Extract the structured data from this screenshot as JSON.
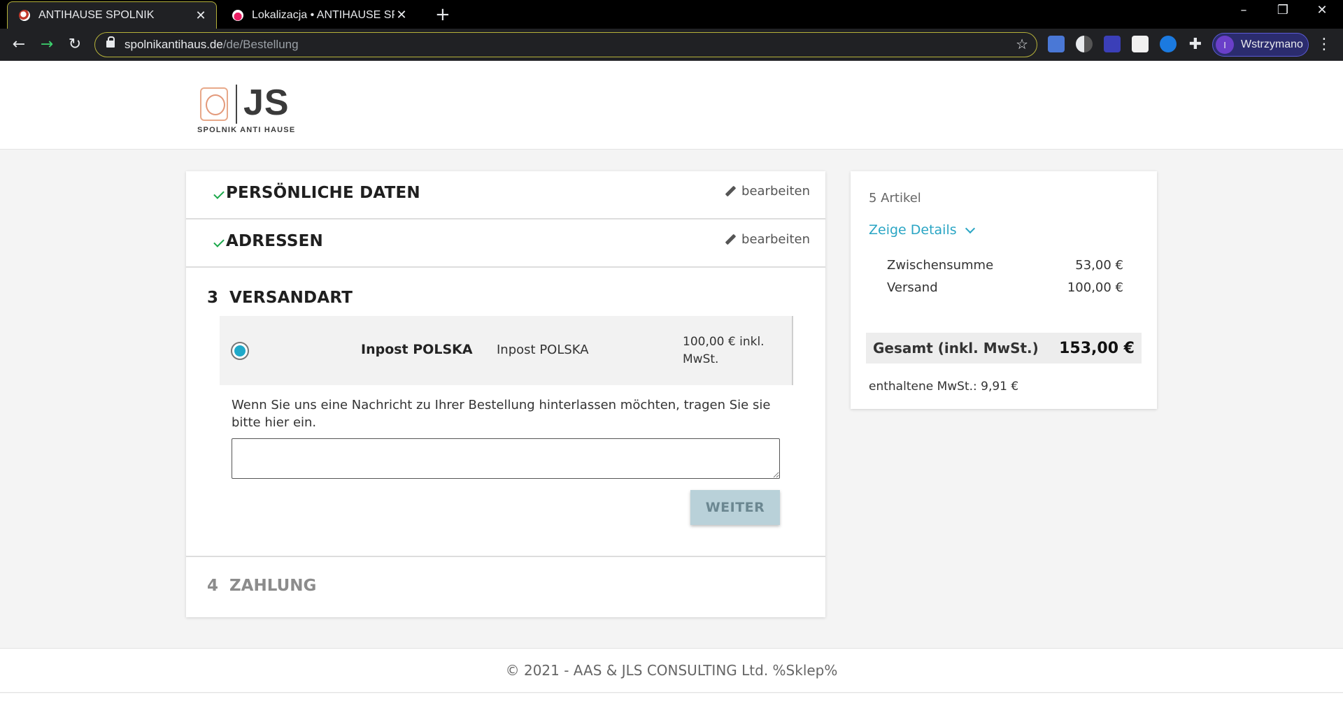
{
  "browser": {
    "tabs": [
      {
        "title": "ANTIHAUSE SPOLNIK",
        "active": true
      },
      {
        "title": "Lokalizacja • ANTIHAUSE SPOLNI",
        "active": false
      }
    ],
    "url_host": "spolnikantihaus.de",
    "url_path": "/de/Bestellung",
    "profile_initial": "I",
    "profile_label": "Wstrzymano",
    "accent_color": "#b5b13a"
  },
  "site": {
    "logo_letters": "JS",
    "logo_tagline": "SPOLNIK ANTI HAUSE"
  },
  "checkout": {
    "steps_done": [
      {
        "title": "PERSÖNLICHE DATEN",
        "edit_label": "bearbeiten"
      },
      {
        "title": "ADRESSEN",
        "edit_label": "bearbeiten"
      }
    ],
    "active_step": {
      "number": "3",
      "title": "VERSANDART",
      "option": {
        "name": "Inpost POLSKA",
        "description": "Inpost POLSKA",
        "price": "100,00 € inkl. MwSt.",
        "selected": true
      },
      "message_label": "Wenn Sie uns eine Nachricht zu Ihrer Bestellung hinterlassen möchten, tragen Sie sie bitte hier ein.",
      "message_value": "",
      "continue_label": "WEITER"
    },
    "pending_step": {
      "number": "4",
      "title": "ZAHLUNG"
    }
  },
  "summary": {
    "item_count": "5 Artikel",
    "details_label": "Zeige Details",
    "subtotal_label": "Zwischensumme",
    "subtotal_value": "53,00 €",
    "shipping_label": "Versand",
    "shipping_value": "100,00 €",
    "total_label": "Gesamt (inkl. MwSt.)",
    "total_value": "153,00 €",
    "vat_note": "enthaltene MwSt.: 9,91 €"
  },
  "footer": {
    "text": "© 2021 - AAS & JLS CONSULTING Ltd. %Sklep%"
  }
}
